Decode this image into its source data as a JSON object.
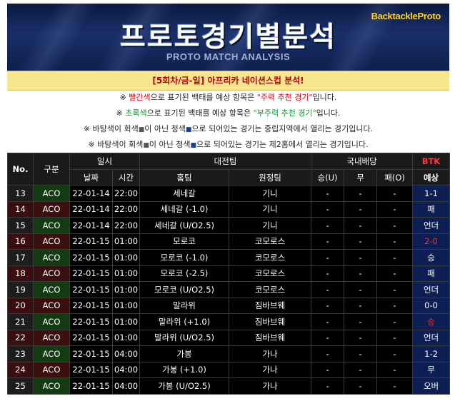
{
  "banner": {
    "brand": "BacktackleProto",
    "title": "프로토경기별분석",
    "subtitle": "PROTO MATCH ANALYSIS"
  },
  "round_title": "[5회차/금-일] 아프리카 네이션스컵 분석!",
  "notes": [
    {
      "pre": "※ ",
      "hl": "빨간색",
      "mid": "으로 표기된 백태를 예상 항목은 ",
      "hl2": "\"주력 추천 경기\"",
      "post": "입니다."
    },
    {
      "pre": "※ ",
      "hl": "초록색",
      "mid": "으로 표기된 백태를 예상 항목은 ",
      "hl2": "\"부주력 추천 경기\"",
      "post": "입니다."
    },
    {
      "text1": "※ 바탕색이 회색",
      "sq": "■",
      "text2": "이 아닌 청색",
      "sq2": "■",
      "text3": "으로 되어있는 경기는 중립지역에서 열리는 경기입니다."
    },
    {
      "text1": "※ 바탕색이 회색",
      "sq": "■",
      "text2": "이 아닌 청색",
      "sq2": "■",
      "text3": "으로 되어있는 경기는 제2홈에서 열리는 경기입니다."
    }
  ],
  "table": {
    "headers": {
      "no": "No.",
      "div": "구분",
      "schedule": "일시",
      "date": "날짜",
      "time": "시간",
      "match": "대전팀",
      "home": "홈팀",
      "away": "원정팀",
      "odds": "국내배당",
      "win": "승(U)",
      "draw": "무",
      "lose": "패(O)",
      "btk": "BTK",
      "pred": "예상"
    },
    "rows": [
      {
        "no": "13",
        "div": "ACO",
        "date": "22-01-14",
        "time": "22:00",
        "home": "세네갈",
        "away": "기니",
        "w": "-",
        "d": "-",
        "l": "-",
        "pred": "1-1",
        "red": false
      },
      {
        "no": "14",
        "div": "ACO",
        "date": "22-01-14",
        "time": "22:00",
        "home": "세네갈 (-1.0)",
        "away": "기니",
        "w": "-",
        "d": "-",
        "l": "-",
        "pred": "패",
        "red": false
      },
      {
        "no": "15",
        "div": "ACO",
        "date": "22-01-14",
        "time": "22:00",
        "home": "세네갈 (U/O2.5)",
        "away": "기니",
        "w": "-",
        "d": "-",
        "l": "-",
        "pred": "언더",
        "red": false
      },
      {
        "no": "16",
        "div": "ACO",
        "date": "22-01-15",
        "time": "01:00",
        "home": "모로코",
        "away": "코모로스",
        "w": "-",
        "d": "-",
        "l": "-",
        "pred": "2-0",
        "red": true
      },
      {
        "no": "17",
        "div": "ACO",
        "date": "22-01-15",
        "time": "01:00",
        "home": "모로코 (-1.0)",
        "away": "코모로스",
        "w": "-",
        "d": "-",
        "l": "-",
        "pred": "승",
        "red": false
      },
      {
        "no": "18",
        "div": "ACO",
        "date": "22-01-15",
        "time": "01:00",
        "home": "모로코 (-2.5)",
        "away": "코모로스",
        "w": "-",
        "d": "-",
        "l": "-",
        "pred": "패",
        "red": false
      },
      {
        "no": "19",
        "div": "ACO",
        "date": "22-01-15",
        "time": "01:00",
        "home": "모로코 (U/O2.5)",
        "away": "코모로스",
        "w": "-",
        "d": "-",
        "l": "-",
        "pred": "언더",
        "red": false
      },
      {
        "no": "20",
        "div": "ACO",
        "date": "22-01-15",
        "time": "01:00",
        "home": "말라위",
        "away": "짐바브웨",
        "w": "-",
        "d": "-",
        "l": "-",
        "pred": "0-0",
        "red": false
      },
      {
        "no": "21",
        "div": "ACO",
        "date": "22-01-15",
        "time": "01:00",
        "home": "말라위 (+1.0)",
        "away": "짐바브웨",
        "w": "-",
        "d": "-",
        "l": "-",
        "pred": "승",
        "red": true
      },
      {
        "no": "22",
        "div": "ACO",
        "date": "22-01-15",
        "time": "01:00",
        "home": "말라위 (U/O2.5)",
        "away": "짐바브웨",
        "w": "-",
        "d": "-",
        "l": "-",
        "pred": "언더",
        "red": false
      },
      {
        "no": "23",
        "div": "ACO",
        "date": "22-01-15",
        "time": "04:00",
        "home": "가봉",
        "away": "가나",
        "w": "-",
        "d": "-",
        "l": "-",
        "pred": "1-2",
        "red": false
      },
      {
        "no": "24",
        "div": "ACO",
        "date": "22-01-15",
        "time": "04:00",
        "home": "가봉 (+1.0)",
        "away": "가나",
        "w": "-",
        "d": "-",
        "l": "-",
        "pred": "무",
        "red": false
      },
      {
        "no": "25",
        "div": "ACO",
        "date": "22-01-15",
        "time": "04:00",
        "home": "가봉 (U/O2.5)",
        "away": "가나",
        "w": "-",
        "d": "-",
        "l": "-",
        "pred": "오버",
        "red": false
      }
    ]
  }
}
